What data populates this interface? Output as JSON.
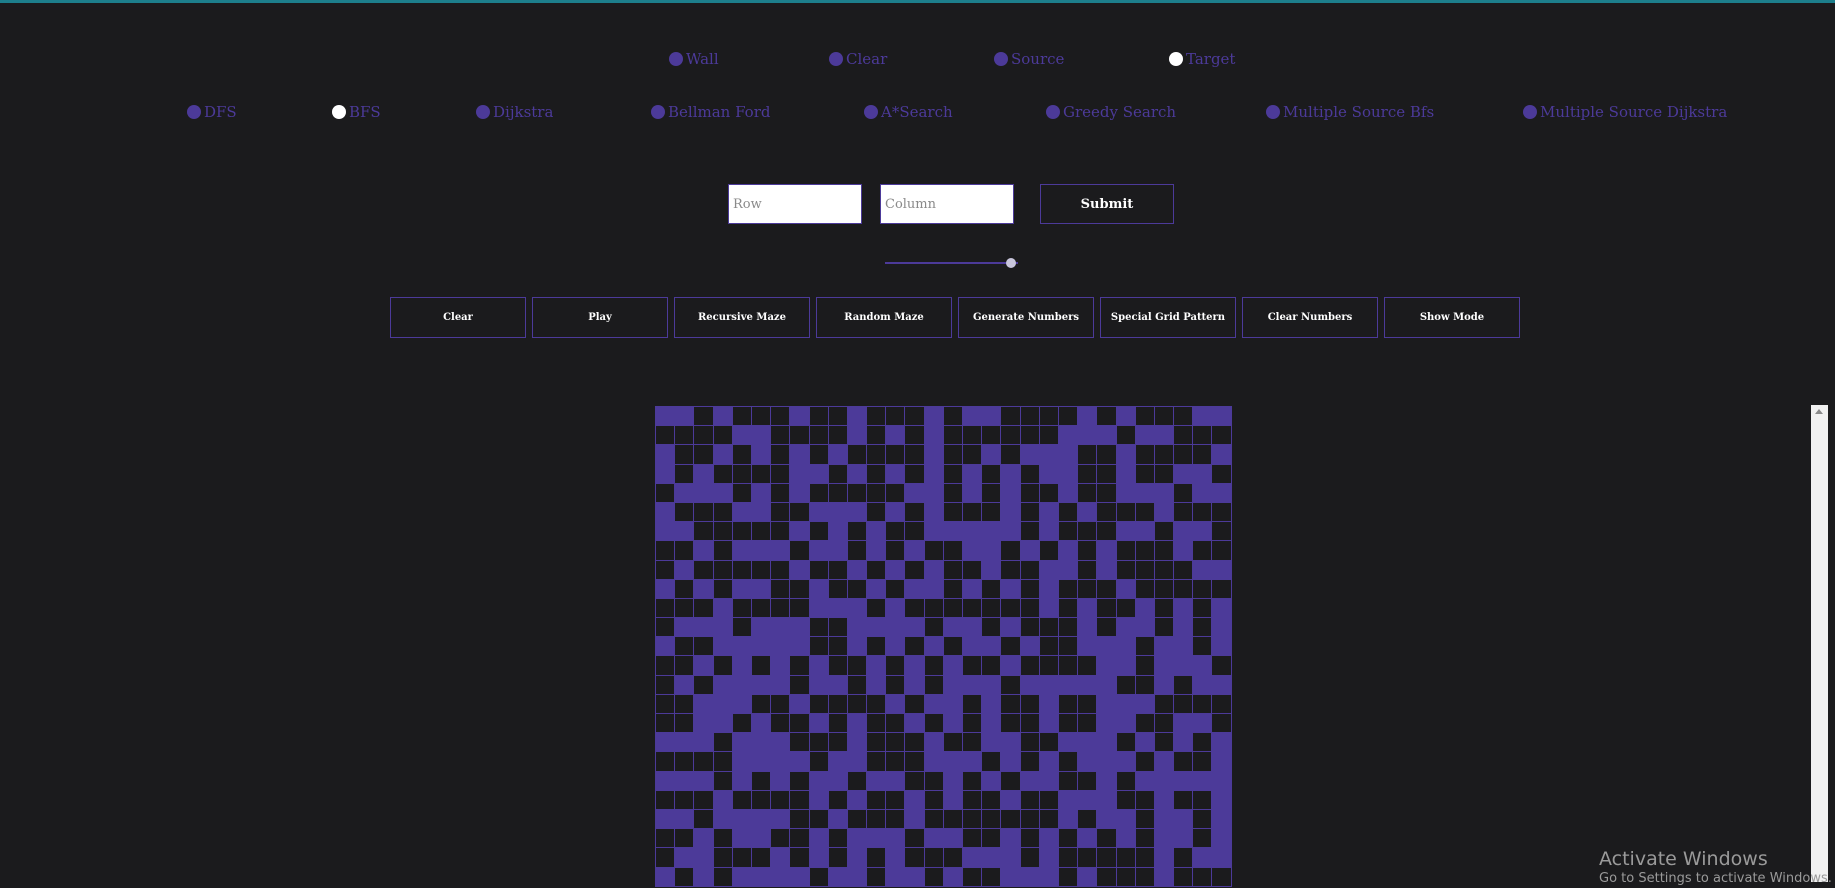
{
  "modes": [
    {
      "label": "Wall",
      "checked": false
    },
    {
      "label": "Clear",
      "checked": false
    },
    {
      "label": "Source",
      "checked": false
    },
    {
      "label": "Target",
      "checked": true
    }
  ],
  "algorithms": [
    {
      "label": "DFS",
      "checked": false
    },
    {
      "label": "BFS",
      "checked": true
    },
    {
      "label": "Dijkstra",
      "checked": false
    },
    {
      "label": "Bellman Ford",
      "checked": false
    },
    {
      "label": "A*Search",
      "checked": false
    },
    {
      "label": "Greedy Search",
      "checked": false
    },
    {
      "label": "Multiple Source Bfs",
      "checked": false
    },
    {
      "label": "Multiple Source Dijkstra",
      "checked": false
    }
  ],
  "form": {
    "row_placeholder": "Row",
    "column_placeholder": "Column",
    "submit_label": "Submit"
  },
  "speed_slider": {
    "value_fraction": 0.96
  },
  "actions": {
    "clear": "Clear",
    "play": "Play",
    "recursive_maze": "Recursive Maze",
    "random_maze": "Random Maze",
    "generate_numbers": "Generate Numbers",
    "special_grid_pattern": "Special Grid Pattern",
    "clear_numbers": "Clear Numbers",
    "show_mode": "Show Mode"
  },
  "grid": {
    "cell_color": "#1b1b1d",
    "wall_color": "#4c3a99",
    "columns": 30,
    "visible_rows": 25,
    "walls_visible": [
      "110100010010001011000010100011",
      "000011000010101000000111011000",
      "100101010100001001011100100001",
      "101000011010101010101100100110",
      "011101010000011010100100111011",
      "100011001110101000101010001000",
      "110000010101001111101000110110",
      "001011101101010011010101000100",
      "010000010010101001001101000011",
      "101011001001011010101000100000",
      "000100001110100000001010010101",
      "011101110011110110100010110101",
      "100111110010101011010011101101",
      "001010101001010100100001101110",
      "010111101101010111011111001011",
      "001110010000101101001001110000",
      "001101001010010101001001100110",
      "111011100010001001100111010101",
      "000011110110001110101011101001",
      "111010101101100101011001011111",
      "000100001010010100100111001001",
      "110111100100010000000101101101",
      "001011001011101100101010101101",
      "011000101010100011101000001011",
      "101011110110110100111010001000"
    ]
  },
  "watermark": {
    "title": "Activate Windows",
    "subtitle": "Go to Settings to activate Windows."
  }
}
